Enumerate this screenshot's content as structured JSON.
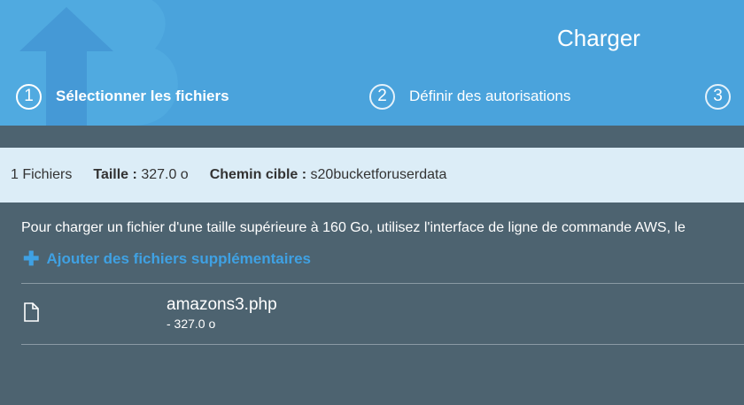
{
  "header": {
    "title": "Charger",
    "steps": [
      {
        "number": "1",
        "label": "Sélectionner les fichiers"
      },
      {
        "number": "2",
        "label": "Définir des autorisations"
      },
      {
        "number": "3"
      }
    ]
  },
  "summary": {
    "count": "1 Fichiers",
    "size_label": "Taille :",
    "size_value": "327.0 o",
    "path_label": "Chemin cible :",
    "path_value": "s20bucketforuserdata"
  },
  "main": {
    "notice": "Pour charger un fichier d'une taille supérieure à 160 Go, utilisez l'interface de ligne de commande AWS, le",
    "add_files_label": "Ajouter des fichiers supplémentaires",
    "files": [
      {
        "name": "amazons3.php",
        "size": "- 327.0 o",
        "icon": "file-icon"
      }
    ]
  },
  "colors": {
    "header_bg": "#4aa3dc",
    "summary_bg": "#dcedf7",
    "body_bg": "#4d6370",
    "link": "#3fa1e3"
  }
}
